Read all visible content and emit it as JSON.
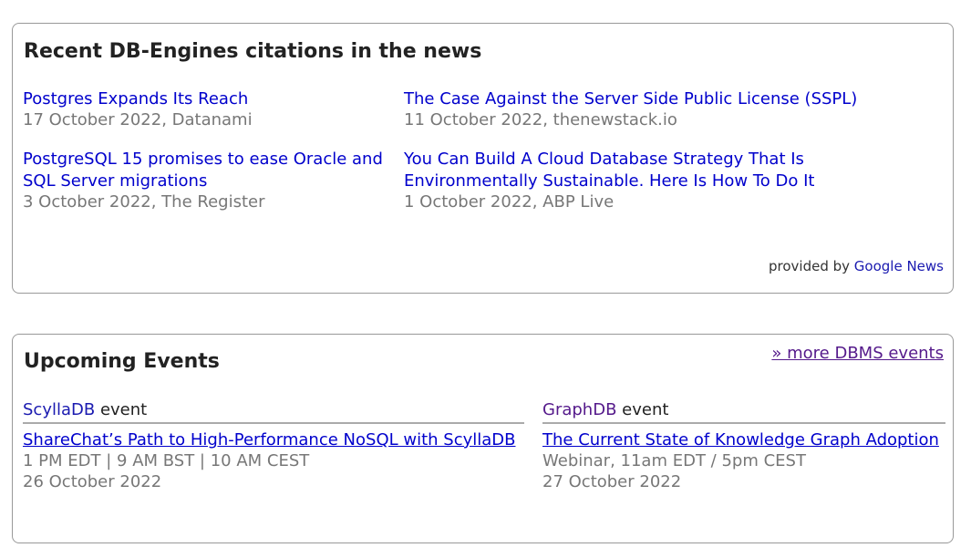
{
  "news": {
    "title": "Recent DB-Engines citations in the news",
    "items": [
      {
        "headline": "Postgres Expands Its Reach",
        "meta": "17 October 2022, Datanami"
      },
      {
        "headline": "The Case Against the Server Side Public License (SSPL)",
        "meta": "11 October 2022, thenewstack.io"
      },
      {
        "headline": "PostgreSQL 15 promises to ease Oracle and SQL Server migrations",
        "meta": "3 October 2022, The Register"
      },
      {
        "headline": "You Can Build A Cloud Database Strategy That Is Environmentally Sustainable. Here Is How To Do It",
        "meta": "1 October 2022, ABP Live"
      }
    ],
    "provided_by_label": "provided by",
    "provided_by_link": "Google News"
  },
  "events": {
    "title": "Upcoming Events",
    "more_link": "» more DBMS events",
    "event_word": "event",
    "items": [
      {
        "org": "ScyllaDB",
        "title": "ShareChat’s Path to High-Performance NoSQL with ScyllaDB",
        "time": "1 PM EDT | 9 AM BST | 10 AM CEST",
        "date": "26 October 2022"
      },
      {
        "org": "GraphDB",
        "title": "The Current State of Knowledge Graph Adoption",
        "time": "Webinar, 11am EDT / 5pm CEST",
        "date": "27 October 2022"
      }
    ]
  }
}
